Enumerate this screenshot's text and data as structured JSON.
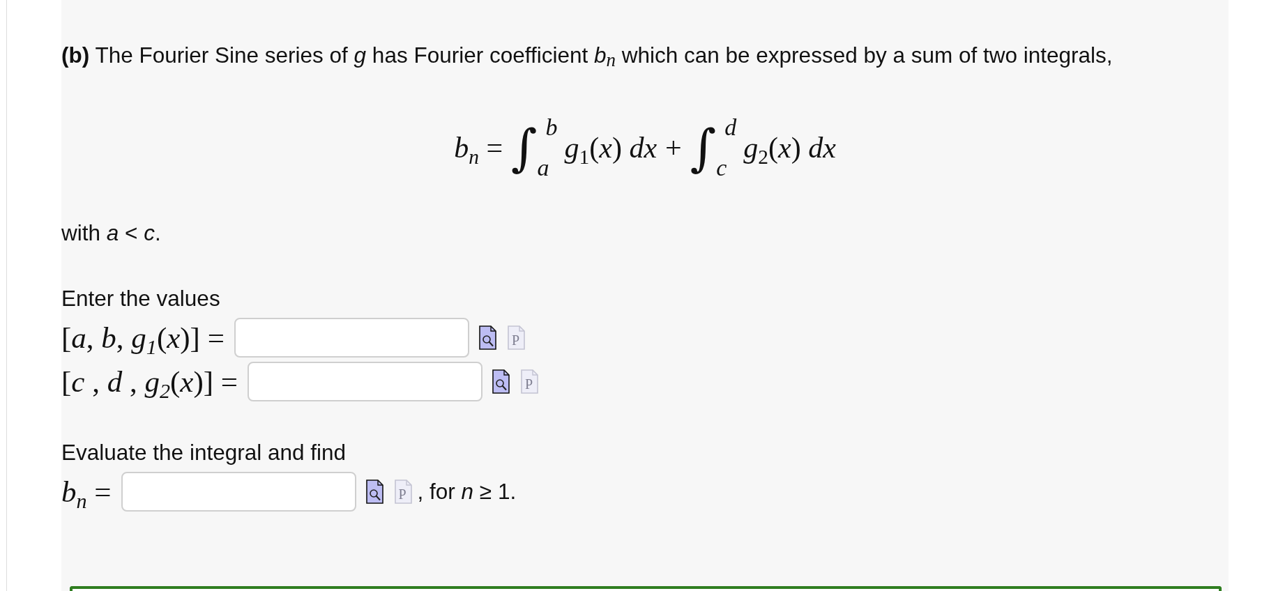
{
  "intro": "**(b)** The Fourier Sine series of *g* has Fourier coefficient *b*$_{n}$ which can be expressed by a sum of two integrals,",
  "equation": [
    {
      "kind": "text",
      "text": "*b*$_{n}$ ="
    },
    {
      "kind": "integral",
      "symbol": "∫",
      "upper": "b",
      "lower": "a",
      "integrand": "*g*$_{1}$(*x*) *dx*"
    },
    {
      "kind": "text",
      "text": "+"
    },
    {
      "kind": "integral",
      "symbol": "∫",
      "upper": "d",
      "lower": "c",
      "integrand": "*g*$_{2}$(*x*) *dx*"
    }
  ],
  "condition": "with *a* < *c*.",
  "sections": [
    {
      "prompt": "Enter the values",
      "answers": [
        {
          "label": "[*a*, *b*, *g*$_{1}$(*x*)] =",
          "preview_button": {
            "disabled": false
          },
          "p_button": {
            "label": "P",
            "disabled": true
          }
        },
        {
          "label": "[*c* , *d* , *g*$_{2}$(*x*)] =",
          "preview_button": {
            "disabled": false
          },
          "p_button": {
            "label": "P",
            "disabled": true
          }
        }
      ]
    },
    {
      "prompt": "Evaluate the integral and find",
      "answers": [
        {
          "label": "*b*$_{n}$ =",
          "preview_button": {
            "disabled": false
          },
          "p_button": {
            "label": "P",
            "disabled": true
          },
          "suffix": ", for *n* ≥ 1."
        }
      ]
    }
  ]
}
